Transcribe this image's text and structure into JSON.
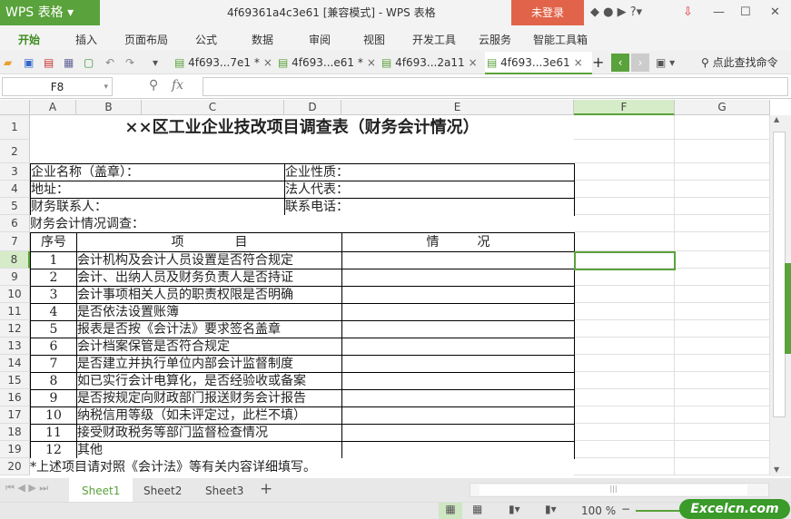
{
  "app": {
    "name": "WPS 表格",
    "title": "4f69361a4c3e61 [兼容模式] - WPS 表格",
    "login": "未登录"
  },
  "menu": [
    "开始",
    "插入",
    "页面布局",
    "公式",
    "数据",
    "审阅",
    "视图",
    "开发工具",
    "云服务",
    "智能工具箱"
  ],
  "doc_tabs": [
    {
      "label": "4f693...7e1 *"
    },
    {
      "label": "4f693...e61 *"
    },
    {
      "label": "4f693...2a11"
    },
    {
      "label": "4f693...3e61",
      "active": true
    }
  ],
  "search_label": "点此查找命令",
  "formula": {
    "cell_ref": "F8",
    "fx": "fx",
    "value": ""
  },
  "columns": [
    "A",
    "B",
    "C",
    "D",
    "E",
    "F",
    "G"
  ],
  "rows": [
    "1",
    "2",
    "3",
    "4",
    "5",
    "6",
    "7",
    "8",
    "9",
    "10",
    "11",
    "12",
    "13",
    "14",
    "15",
    "16",
    "17",
    "18",
    "19",
    "20"
  ],
  "sheet": {
    "title": "××区工业企业技改项目调查表（财务会计情况）",
    "company_name": "企业名称（盖章）：",
    "company_type": "企业性质：",
    "address": "地址：",
    "legal_rep": "法人代表：",
    "contact": "财务联系人：",
    "phone": "联系电话：",
    "survey": "财务会计情况调查：",
    "hdr_no": "序号",
    "hdr_item": "项　　　　目",
    "hdr_status": "情　　　况",
    "items": [
      {
        "no": "1",
        "text": "会计机构及会计人员设置是否符合规定"
      },
      {
        "no": "2",
        "text": "会计、出纳人员及财务负责人是否持证"
      },
      {
        "no": "3",
        "text": "会计事项相关人员的职责权限是否明确"
      },
      {
        "no": "4",
        "text": "是否依法设置账簿"
      },
      {
        "no": "5",
        "text": "报表是否按《会计法》要求签名盖章"
      },
      {
        "no": "6",
        "text": "会计档案保管是否符合规定"
      },
      {
        "no": "7",
        "text": "是否建立并执行单位内部会计监督制度"
      },
      {
        "no": "8",
        "text": "如已实行会计电算化，是否经验收或备案"
      },
      {
        "no": "9",
        "text": "是否按规定向财政部门报送财务会计报告"
      },
      {
        "no": "10",
        "text": "纳税信用等级（如未评定过，此栏不填）"
      },
      {
        "no": "11",
        "text": "接受财政税务等部门监督检查情况"
      },
      {
        "no": "12",
        "text": "其他"
      }
    ],
    "footnote": "*上述项目请对照《会计法》等有关内容详细填写。"
  },
  "sheets": [
    "Sheet1",
    "Sheet2",
    "Sheet3"
  ],
  "active_sheet": "Sheet1",
  "zoom": "100 %",
  "watermark": "Excelcn.com",
  "colors": {
    "accent": "#5aa23b",
    "login": "#e1644a"
  }
}
